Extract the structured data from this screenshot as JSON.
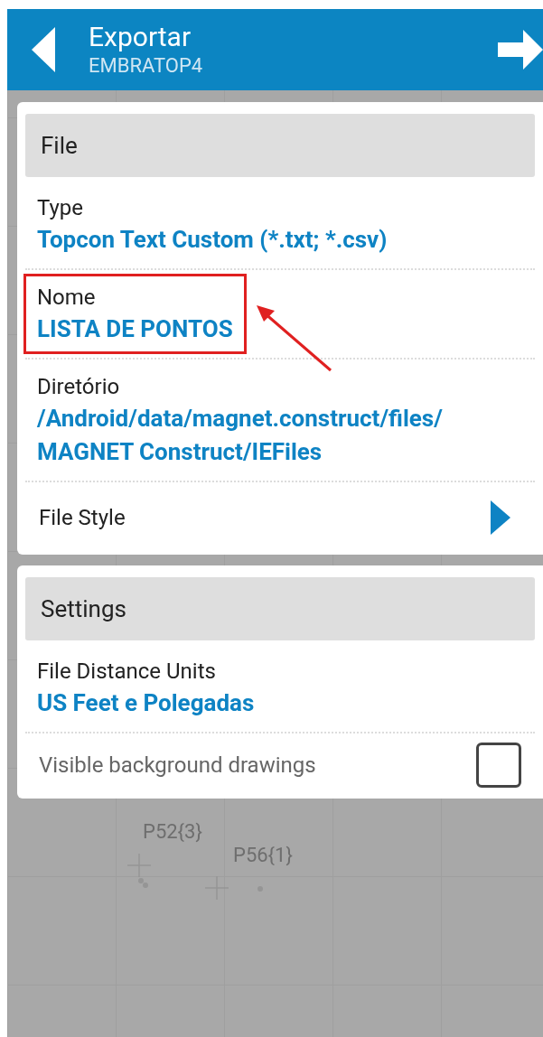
{
  "header": {
    "title": "Exportar",
    "subtitle": "EMBRATOP4"
  },
  "sections": [
    {
      "title": "File",
      "items": [
        {
          "kind": "value",
          "label": "Type",
          "value_lines": [
            "Topcon Text Custom (*.txt; *.csv)"
          ],
          "highlighted": false
        },
        {
          "kind": "value",
          "label": "Nome",
          "value_lines": [
            "LISTA DE PONTOS"
          ],
          "highlighted": true
        },
        {
          "kind": "value",
          "label": "Diretório",
          "value_lines": [
            "/Android/data/magnet.construct/files/",
            "MAGNET Construct/IEFiles"
          ],
          "highlighted": false
        },
        {
          "kind": "nav",
          "label": "File Style"
        }
      ]
    },
    {
      "title": "Settings",
      "items": [
        {
          "kind": "value",
          "label": "File Distance Units",
          "value_lines": [
            "US Feet e Polegadas"
          ],
          "highlighted": false
        },
        {
          "kind": "checkbox",
          "label": "Visible background drawings",
          "checked": false
        }
      ]
    }
  ],
  "map": {
    "labels": [
      "P52{3}",
      "P56{1}"
    ]
  }
}
